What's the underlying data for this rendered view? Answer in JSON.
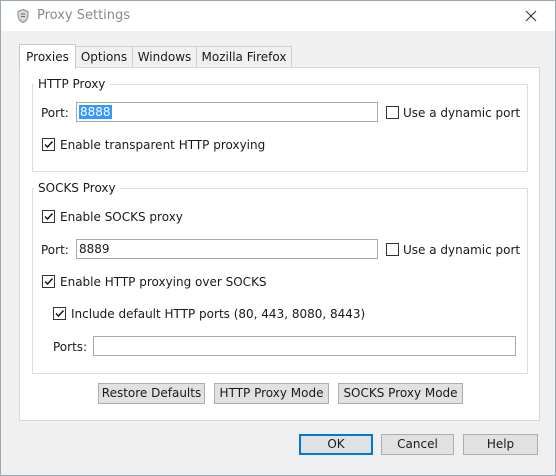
{
  "window": {
    "title": "Proxy Settings"
  },
  "tabs": [
    {
      "label": "Proxies",
      "active": true
    },
    {
      "label": "Options",
      "active": false
    },
    {
      "label": "Windows",
      "active": false
    },
    {
      "label": "Mozilla Firefox",
      "active": false
    }
  ],
  "http_proxy": {
    "group_label": "HTTP Proxy",
    "port_label": "Port:",
    "port_value": "8888",
    "dynamic_port_label": "Use a dynamic port",
    "dynamic_port_checked": false,
    "transparent_label": "Enable transparent HTTP proxying",
    "transparent_checked": true
  },
  "socks_proxy": {
    "group_label": "SOCKS Proxy",
    "enable_label": "Enable SOCKS proxy",
    "enable_checked": true,
    "port_label": "Port:",
    "port_value": "8889",
    "dynamic_port_label": "Use a dynamic port",
    "dynamic_port_checked": false,
    "http_over_socks_label": "Enable HTTP proxying over SOCKS",
    "http_over_socks_checked": true,
    "include_ports_label": "Include default HTTP ports (80, 443, 8080, 8443)",
    "include_ports_checked": true,
    "ports_label": "Ports:",
    "ports_value": ""
  },
  "mode_buttons": {
    "restore": "Restore Defaults",
    "http_mode": "HTTP Proxy Mode",
    "socks_mode": "SOCKS Proxy Mode"
  },
  "dialog_buttons": {
    "ok": "OK",
    "cancel": "Cancel",
    "help": "Help"
  },
  "icons": {
    "app": "fiddler-shield-icon",
    "close": "close-icon",
    "check": "checkmark-icon"
  },
  "colors": {
    "accent": "#0078d7",
    "selection": "#3399ff",
    "check": "#1a1a1a"
  }
}
